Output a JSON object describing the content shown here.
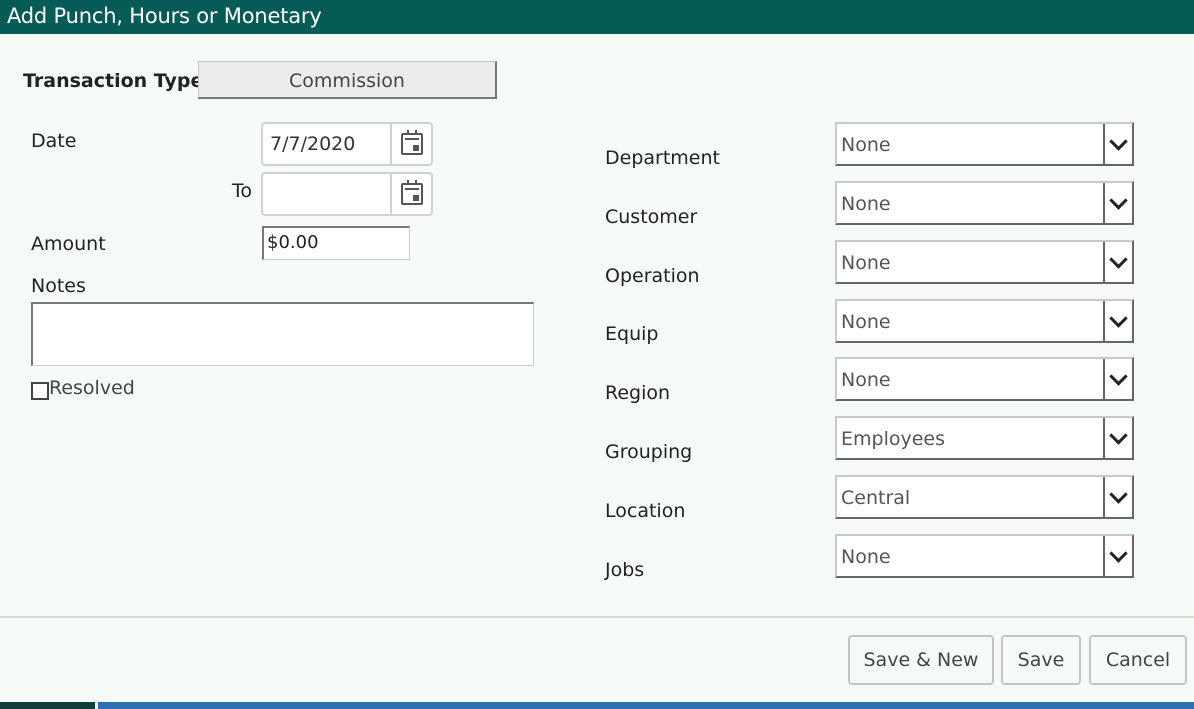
{
  "dialog": {
    "title": "Add Punch, Hours or Monetary"
  },
  "transaction": {
    "label": "Transaction Type",
    "value": "Commission"
  },
  "date": {
    "label": "Date",
    "value": "7/7/2020",
    "to_label": "To",
    "to_value": ""
  },
  "amount": {
    "label": "Amount",
    "value": "$0.00"
  },
  "notes": {
    "label": "Notes",
    "value": ""
  },
  "resolved": {
    "label": "Resolved",
    "checked": false
  },
  "fields": [
    {
      "label": "Department",
      "value": "None"
    },
    {
      "label": "Customer",
      "value": "None"
    },
    {
      "label": "Operation",
      "value": "None"
    },
    {
      "label": "Equip",
      "value": "None"
    },
    {
      "label": "Region",
      "value": "None"
    },
    {
      "label": "Grouping",
      "value": "Employees"
    },
    {
      "label": "Location",
      "value": "Central"
    },
    {
      "label": "Jobs",
      "value": "None"
    }
  ],
  "buttons": {
    "save_new": "Save & New",
    "save": "Save",
    "cancel": "Cancel"
  },
  "icons": {
    "calendar": "calendar-icon",
    "dropdown": "chevron-down-icon"
  },
  "colors": {
    "titlebar": "#075b57",
    "background": "#f7fbf7"
  }
}
